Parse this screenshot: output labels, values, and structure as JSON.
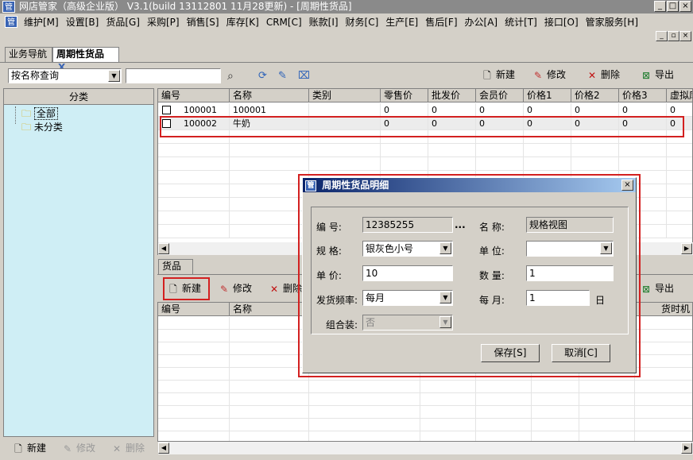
{
  "window": {
    "title": "网店管家（高级企业版） V3.1(build 13112801 11月28更新) - [周期性货品]",
    "app_icon": "管"
  },
  "menu": [
    "维护[M]",
    "设置[B]",
    "货品[G]",
    "采购[P]",
    "销售[S]",
    "库存[K]",
    "CRM[C]",
    "账款[I]",
    "财务[C]",
    "生产[E]",
    "售后[F]",
    "办公[A]",
    "统计[T]",
    "接口[O]",
    "管家服务[H]"
  ],
  "tabs": {
    "nav": "业务导航",
    "active": "周期性货品",
    "close": "X"
  },
  "toolbar": {
    "query_mode": "按名称查询",
    "search_value": "",
    "new": "新建",
    "edit": "修改",
    "delete": "删除",
    "export": "导出"
  },
  "category": {
    "header": "分类",
    "items": [
      "全部",
      "未分类"
    ]
  },
  "grid": {
    "columns": [
      "编号",
      "名称",
      "类别",
      "零售价",
      "批发价",
      "会员价",
      "价格1",
      "价格2",
      "价格3",
      "虚拟库"
    ],
    "rows": [
      {
        "code": "100001",
        "name": "100001",
        "category": "",
        "retail": "0",
        "wholesale": "0",
        "member": "0",
        "p1": "0",
        "p2": "0",
        "p3": "0",
        "virtual": "0"
      },
      {
        "code": "100002",
        "name": "牛奶",
        "category": "",
        "retail": "0",
        "wholesale": "0",
        "member": "0",
        "p1": "0",
        "p2": "0",
        "p3": "0",
        "virtual": "0"
      }
    ]
  },
  "lower": {
    "tab": "货品",
    "new": "新建",
    "edit": "修改",
    "delete": "删除",
    "export": "导出",
    "columns": [
      "编号",
      "名称"
    ],
    "right_col": "货时机"
  },
  "left_bottom": {
    "new": "新建",
    "edit": "修改",
    "delete": "删除"
  },
  "dialog": {
    "title": "周期性货品明细",
    "code_label": "编    号:",
    "code_value": "12385255",
    "ellipsis": "...",
    "name_label": "名    称:",
    "name_value": "规格视图",
    "spec_label": "规    格:",
    "spec_value": "银灰色小号",
    "unit_label": "单    位:",
    "unit_value": "",
    "price_label": "单    价:",
    "price_value": "10",
    "qty_label": "数    量:",
    "qty_value": "1",
    "freq_label": "发货频率:",
    "freq_value": "每月",
    "month_label": "每    月:",
    "month_value": "1",
    "day_label": "日",
    "combo_label": "组合装:",
    "combo_value": "否",
    "save": "保存[S]",
    "cancel": "取消[C]"
  },
  "colors": {
    "title_gradient_start": "#0a246a",
    "title_gradient_end": "#a6caf0",
    "highlight": "#d32020",
    "tree_bg": "#cfeef5"
  }
}
